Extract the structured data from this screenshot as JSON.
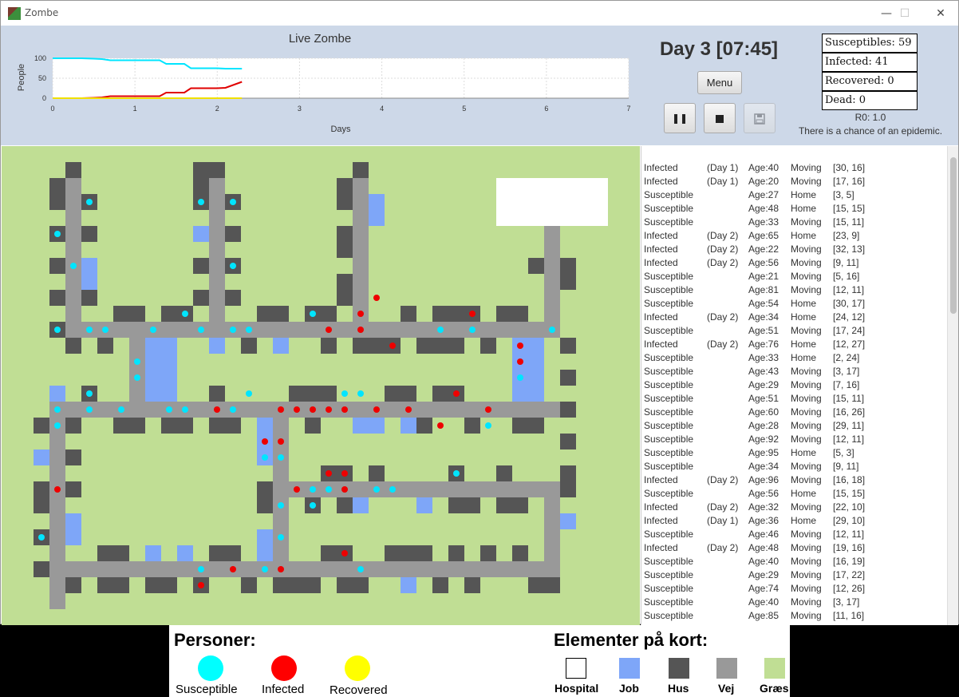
{
  "window": {
    "title": "Zombe",
    "minimize": "—",
    "maximize": "☐",
    "close": "✕"
  },
  "header": {
    "chart_title": "Live Zombe",
    "day_label": "Day 3 [07:45]",
    "menu_label": "Menu",
    "pause_icon": "pause-icon",
    "stop_icon": "stop-icon",
    "save_icon": "save-icon"
  },
  "stats": {
    "susceptibles": "Susceptibles: 59",
    "infected": "Infected: 41",
    "recovered": "Recovered: 0",
    "dead": "Dead: 0",
    "r0": "R0: 1.0",
    "epidemic": "There is a chance of an epidemic."
  },
  "chart_data": {
    "type": "line",
    "title": "Live Zombe",
    "xlabel": "Days",
    "ylabel": "People",
    "xlim": [
      0,
      7
    ],
    "ylim": [
      0,
      100
    ],
    "xticks": [
      "0",
      "1",
      "2",
      "3",
      "4",
      "5",
      "6",
      "7"
    ],
    "yticks": [
      "0",
      "50",
      "100"
    ],
    "grid": true,
    "colors": {
      "susceptible": "#00e5ff",
      "infected": "#e00000",
      "recovered": "#f0e000"
    },
    "series": [
      {
        "key": "susceptible",
        "x": [
          0,
          0.35,
          0.5,
          0.6,
          0.7,
          1.3,
          1.38,
          1.6,
          1.68,
          2.0,
          2.1,
          2.3
        ],
        "y": [
          100,
          100,
          99,
          98,
          95,
          95,
          86,
          86,
          75,
          75,
          74,
          74
        ]
      },
      {
        "key": "infected",
        "x": [
          0,
          0.35,
          0.5,
          0.6,
          0.7,
          1.3,
          1.38,
          1.6,
          1.68,
          2.0,
          2.1,
          2.3
        ],
        "y": [
          0,
          0,
          1,
          2,
          5,
          5,
          14,
          14,
          25,
          25,
          26,
          41
        ]
      },
      {
        "key": "recovered",
        "x": [
          0,
          2.3
        ],
        "y": [
          0,
          0
        ]
      }
    ]
  },
  "map": {
    "colors": {
      "grass": "#c0de94",
      "road": "#999999",
      "house": "#555555",
      "job": "#7ea6f8",
      "hospital": "#ffffff",
      "susceptible": "#00e5ff",
      "infected": "#ee0000"
    }
  },
  "log": [
    [
      "Infected",
      "(Day 1)",
      "Age:40",
      "Moving",
      "[30, 16]"
    ],
    [
      "Infected",
      "(Day 1)",
      "Age:20",
      "Moving",
      "[17, 16]"
    ],
    [
      "Susceptible",
      "",
      "Age:27",
      "Home",
      "[3, 5]"
    ],
    [
      "Susceptible",
      "",
      "Age:48",
      "Home",
      "[15, 15]"
    ],
    [
      "Susceptible",
      "",
      "Age:33",
      "Moving",
      "[15, 11]"
    ],
    [
      "Infected",
      "(Day 2)",
      "Age:65",
      "Home",
      "[23, 9]"
    ],
    [
      "Infected",
      "(Day 2)",
      "Age:22",
      "Moving",
      "[32, 13]"
    ],
    [
      "Infected",
      "(Day 2)",
      "Age:56",
      "Moving",
      "[9, 11]"
    ],
    [
      "Susceptible",
      "",
      "Age:21",
      "Moving",
      "[5, 16]"
    ],
    [
      "Susceptible",
      "",
      "Age:81",
      "Moving",
      "[12, 11]"
    ],
    [
      "Susceptible",
      "",
      "Age:54",
      "Home",
      "[30, 17]"
    ],
    [
      "Infected",
      "(Day 2)",
      "Age:34",
      "Home",
      "[24, 12]"
    ],
    [
      "Susceptible",
      "",
      "Age:51",
      "Moving",
      "[17, 24]"
    ],
    [
      "Infected",
      "(Day 2)",
      "Age:76",
      "Home",
      "[12, 27]"
    ],
    [
      "Susceptible",
      "",
      "Age:33",
      "Home",
      "[2, 24]"
    ],
    [
      "Susceptible",
      "",
      "Age:43",
      "Moving",
      "[3, 17]"
    ],
    [
      "Susceptible",
      "",
      "Age:29",
      "Moving",
      "[7, 16]"
    ],
    [
      "Susceptible",
      "",
      "Age:51",
      "Moving",
      "[15, 11]"
    ],
    [
      "Susceptible",
      "",
      "Age:60",
      "Moving",
      "[16, 26]"
    ],
    [
      "Susceptible",
      "",
      "Age:28",
      "Moving",
      "[29, 11]"
    ],
    [
      "Susceptible",
      "",
      "Age:92",
      "Moving",
      "[12, 11]"
    ],
    [
      "Susceptible",
      "",
      "Age:95",
      "Home",
      "[5, 3]"
    ],
    [
      "Susceptible",
      "",
      "Age:34",
      "Moving",
      "[9, 11]"
    ],
    [
      "Infected",
      "(Day 2)",
      "Age:96",
      "Moving",
      "[16, 18]"
    ],
    [
      "Susceptible",
      "",
      "Age:56",
      "Home",
      "[15, 15]"
    ],
    [
      "Infected",
      "(Day 2)",
      "Age:32",
      "Moving",
      "[22, 10]"
    ],
    [
      "Infected",
      "(Day 1)",
      "Age:36",
      "Home",
      "[29, 10]"
    ],
    [
      "Susceptible",
      "",
      "Age:46",
      "Moving",
      "[12, 11]"
    ],
    [
      "Infected",
      "(Day 2)",
      "Age:48",
      "Moving",
      "[19, 16]"
    ],
    [
      "Susceptible",
      "",
      "Age:40",
      "Moving",
      "[16, 19]"
    ],
    [
      "Susceptible",
      "",
      "Age:29",
      "Moving",
      "[17, 22]"
    ],
    [
      "Susceptible",
      "",
      "Age:74",
      "Moving",
      "[12, 26]"
    ],
    [
      "Susceptible",
      "",
      "Age:40",
      "Moving",
      "[3, 17]"
    ],
    [
      "Susceptible",
      "",
      "Age:85",
      "Moving",
      "[11, 16]"
    ]
  ],
  "legend": {
    "persons_title": "Personer:",
    "elements_title": "Elementer på kort:",
    "persons": [
      {
        "label": "Susceptible",
        "color": "#00ffff"
      },
      {
        "label": "Infected",
        "color": "#ff0000"
      },
      {
        "label": "Recovered",
        "color": "#ffff00"
      }
    ],
    "elements": [
      {
        "label": "Hospital",
        "color": "#ffffff"
      },
      {
        "label": "Job",
        "color": "#7ea6f8"
      },
      {
        "label": "Hus",
        "color": "#555555"
      },
      {
        "label": "Vej",
        "color": "#999999"
      },
      {
        "label": "Græs",
        "color": "#c0de94"
      }
    ]
  }
}
